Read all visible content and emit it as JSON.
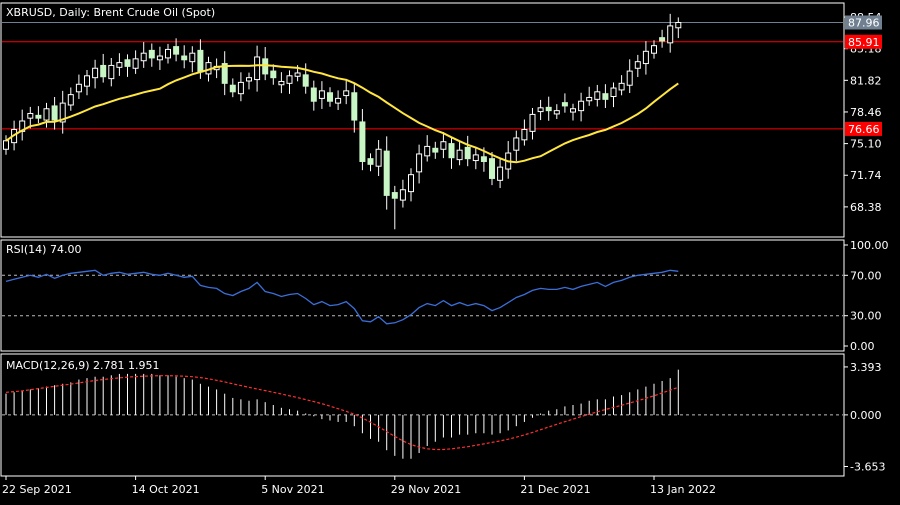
{
  "header": {
    "symbol": "XBRUSD",
    "timeframe": "Daily",
    "instrument": "Brent Crude Oil (Spot)"
  },
  "colors": {
    "background": "#000000",
    "frame": "#ffffff",
    "bull_candle": "#ffffff",
    "bear_candle": "#c8f7c5",
    "sma": "#ffe640",
    "level_line": "#ff0000",
    "rsi": "#3b6fd8",
    "macd_hist": "#ffffff",
    "macd_signal": "#ff3030",
    "price_tag": "#708090",
    "level_tag": "#ff0000"
  },
  "chart_data": [
    {
      "type": "candlestick",
      "panel": "price",
      "ylim": [
        65.5,
        89.5
      ],
      "yticks": [
        88.54,
        85.18,
        81.82,
        78.46,
        75.1,
        71.74,
        68.38
      ],
      "ytick_labels": [
        "88.54",
        "85.18",
        "81.82",
        "78.46",
        "75.10",
        "71.74",
        "68.38"
      ],
      "current_price": {
        "value": 87.96,
        "label": "87.96"
      },
      "levels": [
        {
          "value": 85.91,
          "label": "85.91"
        },
        {
          "value": 76.66,
          "label": "76.66"
        }
      ],
      "x_labels": [
        {
          "index": 0,
          "label": "22 Sep 2021"
        },
        {
          "index": 16,
          "label": "14 Oct 2021"
        },
        {
          "index": 32,
          "label": "5 Nov 2021"
        },
        {
          "index": 48,
          "label": "29 Nov 2021"
        },
        {
          "index": 64,
          "label": "21 Dec 2021"
        },
        {
          "index": 80,
          "label": "13 Jan 2022"
        }
      ],
      "closes": [
        75.4,
        76.6,
        77.5,
        78.3,
        77.8,
        78.8,
        77.6,
        79.4,
        80.3,
        81.4,
        82.3,
        83.1,
        82.2,
        83.4,
        83.7,
        83.3,
        84.1,
        84.7,
        84.2,
        84.4,
        85.1,
        84.6,
        84.0,
        84.7,
        82.7,
        83.7,
        83.3,
        81.5,
        80.6,
        81.6,
        82.1,
        84.3,
        82.5,
        82.1,
        81.7,
        82.3,
        82.6,
        81.2,
        79.6,
        80.7,
        79.6,
        79.9,
        80.7,
        77.6,
        73.2,
        72.9,
        74.5,
        69.6,
        69.3,
        70.2,
        71.8,
        74.0,
        74.8,
        74.2,
        75.3,
        73.6,
        74.4,
        73.5,
        73.9,
        73.2,
        71.4,
        72.6,
        74.1,
        75.7,
        76.6,
        78.2,
        78.9,
        78.6,
        78.6,
        79.1,
        78.8,
        79.6,
        80.0,
        80.6,
        79.8,
        81.0,
        81.5,
        82.8,
        83.8,
        84.9,
        85.5,
        86.0,
        87.6,
        87.96
      ],
      "series": [
        {
          "name": "open_high_low",
          "note": "derived from closes"
        }
      ]
    },
    {
      "type": "line",
      "panel": "rsi",
      "indicator_label": "RSI(14) 74.00",
      "ylim": [
        0,
        100
      ],
      "yticks": [
        100,
        70,
        30,
        0
      ],
      "ytick_labels": [
        "100.00",
        "70.00",
        "30.00",
        "0.00"
      ],
      "dashed_levels": [
        70,
        30
      ],
      "values": [
        64,
        66,
        68,
        70,
        68,
        71,
        67,
        70,
        72,
        73,
        74,
        75,
        70,
        72,
        73,
        71,
        72,
        73,
        71,
        70,
        72,
        70,
        68,
        69,
        60,
        58,
        57,
        52,
        50,
        54,
        57,
        63,
        54,
        52,
        49,
        51,
        52,
        47,
        41,
        44,
        40,
        41,
        44,
        37,
        25,
        24,
        29,
        22,
        23,
        26,
        31,
        38,
        42,
        40,
        45,
        40,
        43,
        40,
        42,
        40,
        35,
        38,
        43,
        48,
        51,
        55,
        57,
        56,
        56,
        58,
        56,
        59,
        61,
        63,
        59,
        63,
        65,
        68,
        70,
        71,
        72,
        73,
        75,
        74
      ]
    },
    {
      "type": "bar",
      "panel": "macd",
      "indicator_label": "MACD(12,26,9) 2.781 1.951",
      "ylim": [
        -3.9,
        3.6
      ],
      "yticks": [
        3.393,
        0.0,
        -3.653
      ],
      "ytick_labels": [
        "3.393",
        "0.000",
        "-3.653"
      ],
      "histogram": [
        1.5,
        1.6,
        1.7,
        1.8,
        1.9,
        2.0,
        2.1,
        2.2,
        2.3,
        2.5,
        2.6,
        2.7,
        2.7,
        2.8,
        2.9,
        2.9,
        2.9,
        2.9,
        2.9,
        2.8,
        2.8,
        2.7,
        2.6,
        2.5,
        2.2,
        2.0,
        1.8,
        1.5,
        1.2,
        1.1,
        1.0,
        1.1,
        0.9,
        0.7,
        0.5,
        0.4,
        0.3,
        0.1,
        -0.1,
        -0.3,
        -0.4,
        -0.5,
        -0.5,
        -0.8,
        -1.3,
        -1.7,
        -1.9,
        -2.5,
        -2.9,
        -3.1,
        -3.1,
        -2.7,
        -2.2,
        -1.9,
        -1.6,
        -1.6,
        -1.4,
        -1.4,
        -1.3,
        -1.3,
        -1.4,
        -1.3,
        -1.1,
        -0.8,
        -0.5,
        -0.2,
        0.1,
        0.3,
        0.4,
        0.6,
        0.7,
        0.8,
        1.0,
        1.1,
        1.1,
        1.3,
        1.4,
        1.6,
        1.8,
        2.0,
        2.2,
        2.4,
        2.6,
        3.2
      ],
      "signal": [
        1.6,
        1.65,
        1.7,
        1.78,
        1.86,
        1.94,
        2.02,
        2.1,
        2.18,
        2.26,
        2.35,
        2.43,
        2.5,
        2.56,
        2.62,
        2.67,
        2.71,
        2.74,
        2.76,
        2.77,
        2.77,
        2.76,
        2.74,
        2.7,
        2.64,
        2.55,
        2.45,
        2.33,
        2.2,
        2.07,
        1.95,
        1.83,
        1.72,
        1.6,
        1.48,
        1.35,
        1.22,
        1.08,
        0.94,
        0.79,
        0.62,
        0.44,
        0.25,
        0.04,
        -0.22,
        -0.52,
        -0.84,
        -1.18,
        -1.52,
        -1.84,
        -2.1,
        -2.28,
        -2.4,
        -2.45,
        -2.45,
        -2.4,
        -2.33,
        -2.25,
        -2.15,
        -2.05,
        -1.95,
        -1.84,
        -1.72,
        -1.58,
        -1.42,
        -1.24,
        -1.05,
        -0.86,
        -0.67,
        -0.48,
        -0.3,
        -0.12,
        0.05,
        0.22,
        0.38,
        0.53,
        0.68,
        0.84,
        1.0,
        1.17,
        1.35,
        1.55,
        1.75,
        1.951
      ]
    }
  ]
}
